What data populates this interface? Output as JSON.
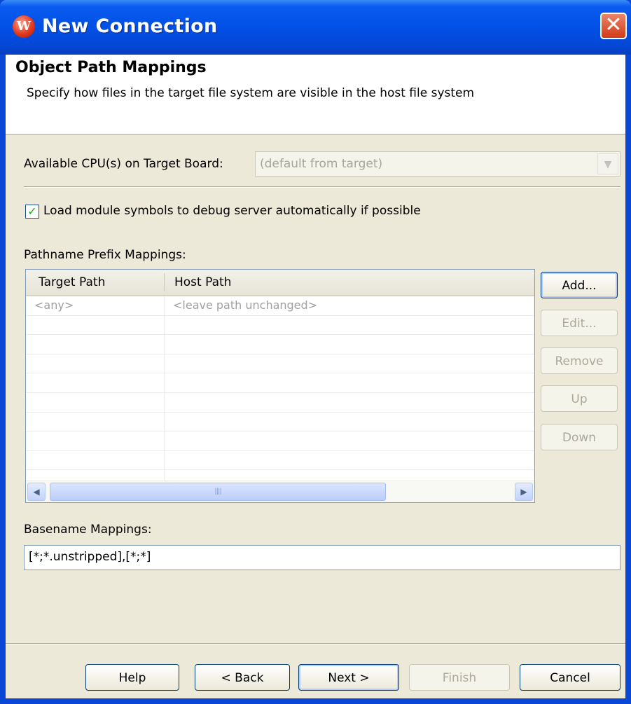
{
  "window": {
    "title": "New Connection",
    "close_glyph": "✕"
  },
  "header": {
    "title": "Object Path Mappings",
    "description": "Specify how files in the target file system are visible in the host file system"
  },
  "cpu": {
    "label": "Available CPU(s) on Target Board:",
    "value": "(default from target)"
  },
  "load_symbols": {
    "checked": true,
    "label": "Load module symbols to debug server automatically if possible"
  },
  "prefix_mappings": {
    "label": "Pathname Prefix Mappings:",
    "columns": [
      "Target Path",
      "Host Path"
    ],
    "rows": [
      [
        "<any>",
        "<leave path unchanged>"
      ]
    ],
    "buttons": {
      "add": "Add...",
      "edit": "Edit...",
      "remove": "Remove",
      "up": "Up",
      "down": "Down"
    }
  },
  "basename": {
    "label": "Basename Mappings:",
    "value": "[*;*.unstripped],[*;*]"
  },
  "footer": {
    "help": "Help",
    "back": "< Back",
    "next": "Next >",
    "finish": "Finish",
    "cancel": "Cancel"
  },
  "icons": [
    "wind-river-app-icon",
    "close-icon",
    "dropdown-arrow-icon",
    "checkmark-icon",
    "scroll-left-icon",
    "scroll-right-icon",
    "scroll-thumb-grip-icon"
  ],
  "colors": {
    "titlebar": "#0250e6",
    "dialog_bg": "#ece9d8",
    "disabled_text": "#aca899"
  }
}
